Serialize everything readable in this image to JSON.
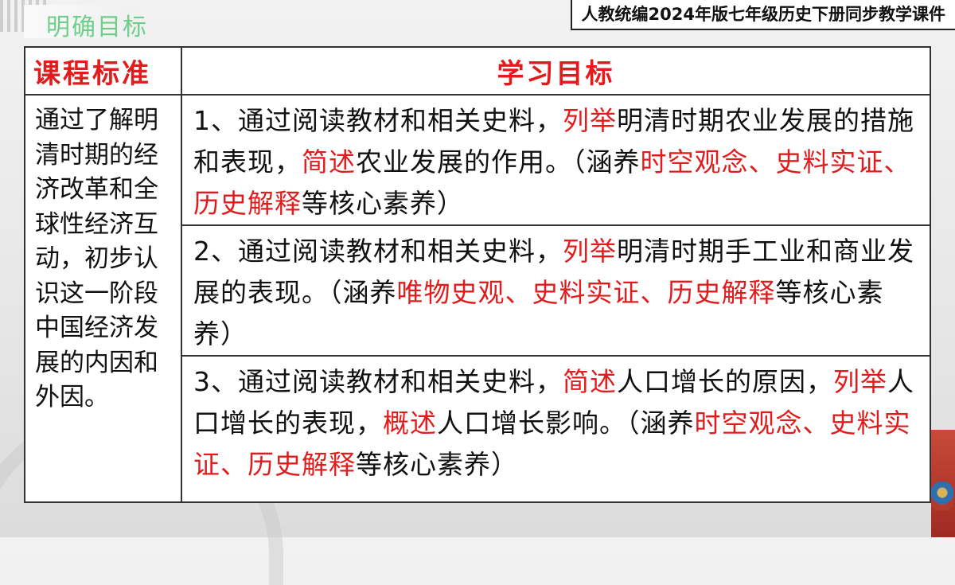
{
  "header": {
    "section_title": "明确目标",
    "course_title": "人教统编2024年版七年级历史下册同步教学课件"
  },
  "table": {
    "col1_header": "课程标准",
    "col2_header": "学习目标",
    "standard": "通过了解明清时期的经济改革和全球性经济互动，初步认识这一阶段中国经济发展的内因和外因。",
    "objectives": [
      [
        {
          "t": "1、通过阅读教材和相关史料，",
          "red": false
        },
        {
          "t": "列举",
          "red": true
        },
        {
          "t": "明清时期农业发展的措施和表现，",
          "red": false
        },
        {
          "t": "简述",
          "red": true
        },
        {
          "t": "农业发展的作用。（涵养",
          "red": false
        },
        {
          "t": "时空观念、史料实证、历史解释",
          "red": true
        },
        {
          "t": "等核心素养）",
          "red": false
        }
      ],
      [
        {
          "t": "2、通过阅读教材和相关史料，",
          "red": false
        },
        {
          "t": "列举",
          "red": true
        },
        {
          "t": "明清时期手工业和商业发展的表现。（涵养",
          "red": false
        },
        {
          "t": "唯物史观、史料实证、历史解释",
          "red": true
        },
        {
          "t": "等核心素养）",
          "red": false
        }
      ],
      [
        {
          "t": "3、通过阅读教材和相关史料，",
          "red": false
        },
        {
          "t": "简述",
          "red": true
        },
        {
          "t": "人口增长的原因，",
          "red": false
        },
        {
          "t": "列举",
          "red": true
        },
        {
          "t": "人口增长的表现，",
          "red": false
        },
        {
          "t": "概述",
          "red": true
        },
        {
          "t": "人口增长影响。（涵养",
          "red": false
        },
        {
          "t": "时空观念、史料实证、历史解释",
          "red": true
        },
        {
          "t": "等核心素养）",
          "red": false
        }
      ]
    ]
  },
  "colors": {
    "accent_red": "#e21c1c",
    "title_green": "#6fcf8a"
  }
}
